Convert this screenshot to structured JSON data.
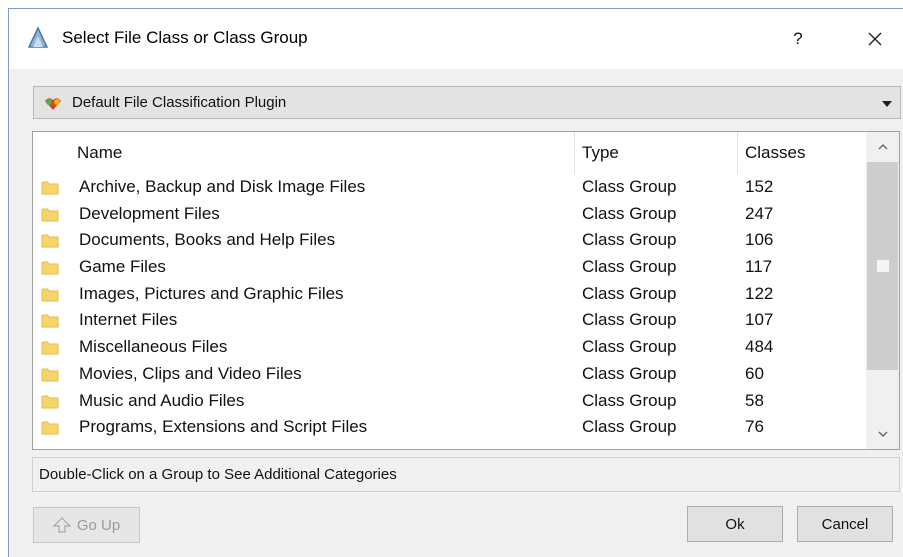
{
  "window": {
    "title": "Select File Class or Class Group",
    "help_label": "?",
    "close_icon": "close-icon"
  },
  "plugin_select": {
    "selected": "Default File Classification Plugin",
    "icon": "plugin-icon"
  },
  "list": {
    "columns": [
      "Name",
      "Type",
      "Classes"
    ],
    "rows": [
      {
        "name": "Archive, Backup and Disk Image Files",
        "type": "Class Group",
        "classes": "152"
      },
      {
        "name": "Development Files",
        "type": "Class Group",
        "classes": "247"
      },
      {
        "name": "Documents, Books and Help Files",
        "type": "Class Group",
        "classes": "106"
      },
      {
        "name": "Game Files",
        "type": "Class Group",
        "classes": "117"
      },
      {
        "name": "Images, Pictures and Graphic Files",
        "type": "Class Group",
        "classes": "122"
      },
      {
        "name": "Internet Files",
        "type": "Class Group",
        "classes": "107"
      },
      {
        "name": "Miscellaneous Files",
        "type": "Class Group",
        "classes": "484"
      },
      {
        "name": "Movies, Clips and Video Files",
        "type": "Class Group",
        "classes": "60"
      },
      {
        "name": "Music and Audio Files",
        "type": "Class Group",
        "classes": "58"
      },
      {
        "name": "Programs, Extensions and Script Files",
        "type": "Class Group",
        "classes": "76"
      }
    ]
  },
  "status": {
    "text": "Double-Click on a Group to See Additional Categories"
  },
  "buttons": {
    "go_up": "Go Up",
    "ok": "Ok",
    "cancel": "Cancel"
  },
  "colors": {
    "folder": "#f5d66b",
    "folder_dark": "#e6b94a",
    "window_border": "#7a9cc6"
  }
}
